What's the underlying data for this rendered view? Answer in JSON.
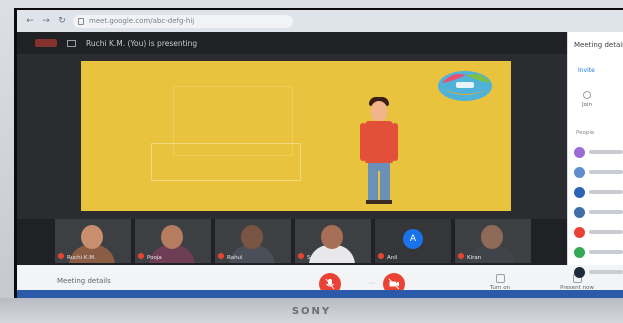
{
  "browser": {
    "url": "meet.google.com/abc-defg-hij",
    "back_icon": "arrow-left-icon",
    "forward_icon": "arrow-right-icon",
    "reload_icon": "reload-icon"
  },
  "meeting": {
    "presenting_label": "Ruchi K.M. (You) is presenting"
  },
  "participants": [
    {
      "name": "Ruchi K.M.",
      "skin": "#c98e6d",
      "shirt": "#8a5c44"
    },
    {
      "name": "Pooja",
      "skin": "#b67c5f",
      "shirt": "#6d3d55"
    },
    {
      "name": "Rahul",
      "skin": "#7a5443",
      "shirt": "#4a4e56"
    },
    {
      "name": "Suresh",
      "skin": "#a66f56",
      "shirt": "#e8e8ea"
    },
    {
      "name": "Anil",
      "avatar": "A"
    },
    {
      "name": "Kiran",
      "skin": "#8f6a56",
      "shirt": "#40444a"
    }
  ],
  "controls": {
    "meeting_details": "Meeting details",
    "end_label": "",
    "present_label": "Present now",
    "captions_label": "Turn on captions"
  },
  "panel": {
    "title": "Meeting details",
    "invite": "Invite",
    "join_label": "Join",
    "people_count": "People",
    "dot_colors": [
      "#9c6bd6",
      "#5f8dd0",
      "#2d63b3",
      "#3f6ea9",
      "#ea4335",
      "#34a853",
      "#1f2a3a"
    ]
  },
  "bezel": {
    "brand": "SONY"
  },
  "colors": {
    "slide_bg": "#e9c33d",
    "danger": "#ea4335",
    "accent": "#1a73e8"
  }
}
